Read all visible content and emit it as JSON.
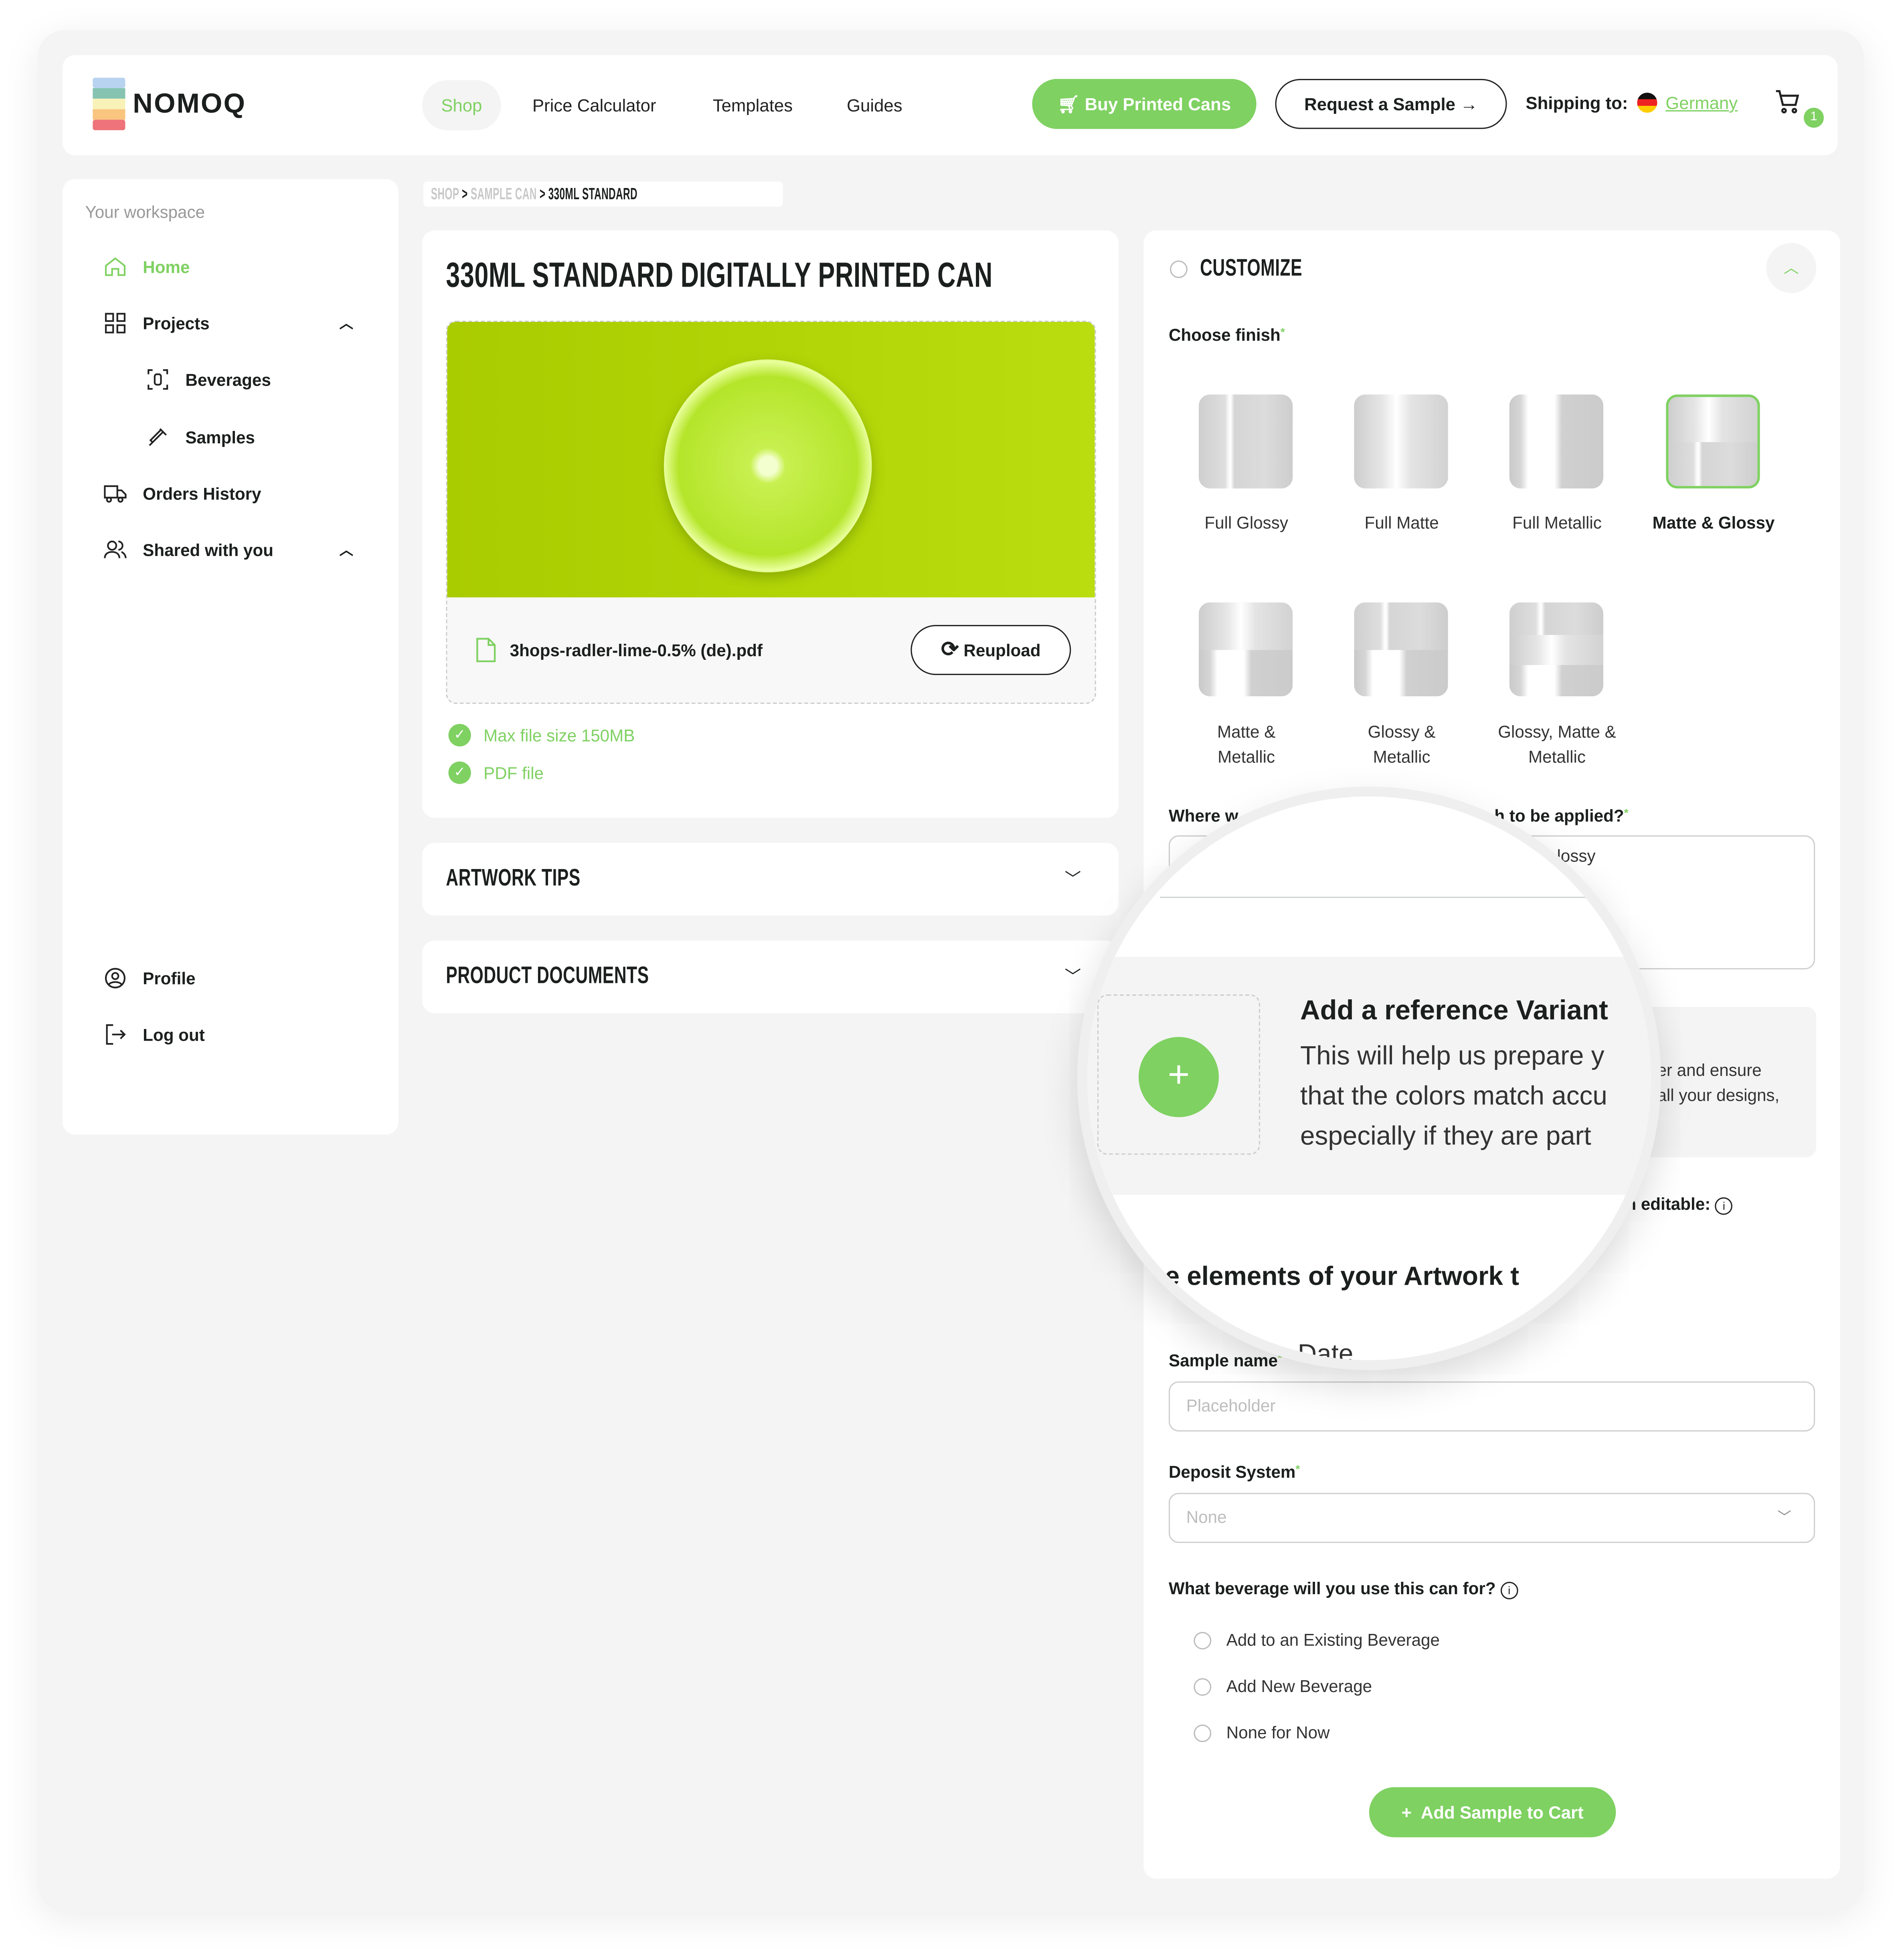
{
  "brand": {
    "name": "NOMOQ",
    "accent": "#7fd162"
  },
  "header": {
    "nav": [
      "Shop",
      "Price Calculator",
      "Templates",
      "Guides"
    ],
    "active_nav": "Shop",
    "buy_button": "Buy Printed Cans",
    "sample_button": "Request a Sample",
    "shipping_label": "Shipping to:",
    "shipping_country": "Germany",
    "cart_count": "1"
  },
  "sidebar": {
    "section": "Your workspace",
    "items": [
      {
        "label": "Home",
        "icon": "home-icon",
        "active": true
      },
      {
        "label": "Projects",
        "icon": "grid-icon",
        "expanded": true
      },
      {
        "label": "Beverages",
        "icon": "can-scan-icon",
        "sub": true
      },
      {
        "label": "Samples",
        "icon": "pipette-icon",
        "sub": true
      },
      {
        "label": "Orders History",
        "icon": "truck-icon"
      },
      {
        "label": "Shared with you",
        "icon": "users-icon",
        "expanded": true
      }
    ],
    "bottom": [
      {
        "label": "Profile",
        "icon": "user-circle-icon"
      },
      {
        "label": "Log out",
        "icon": "logout-icon"
      }
    ]
  },
  "breadcrumb": [
    "SHOP",
    "SAMPLE CAN",
    "330ML STANDARD"
  ],
  "product": {
    "title": "330ML STANDARD DIGITALLY PRINTED CAN",
    "file_name": "3hops-radler-lime-0.5% (de).pdf",
    "reupload": "Reupload",
    "checks": [
      "Max file size 150MB",
      "PDF file"
    ]
  },
  "accordions": [
    "ARTWORK TIPS",
    "PRODUCT DOCUMENTS"
  ],
  "customize": {
    "title": "CUSTOMIZE",
    "choose_finish": "Choose finish",
    "finishes": [
      {
        "label": "Full Glossy",
        "selected": false
      },
      {
        "label": "Full Matte",
        "selected": false
      },
      {
        "label": "Full Metallic",
        "selected": false
      },
      {
        "label": "Matte & Glossy",
        "selected": true
      },
      {
        "label": "Matte & Metallic",
        "selected": false
      },
      {
        "label": "Glossy & Metallic",
        "selected": false
      },
      {
        "label": "Glossy, Matte & Metallic",
        "selected": false
      }
    ],
    "where_label_start": "Where w",
    "where_label_end": "h to be applied?",
    "where_value_fragment": "lossy",
    "info_fragment_1": "er and ensure",
    "info_fragment_2": "all your designs,",
    "editable_fragment": "n editable:",
    "sample_name_label": "Sample name",
    "sample_name_placeholder": "Placeholder",
    "deposit_label": "Deposit System",
    "deposit_value": "None",
    "beverage_question": "What beverage will you use this can for?",
    "beverage_options": [
      "Add to an Existing Beverage",
      "Add New Beverage",
      "None for Now"
    ],
    "add_to_cart": "Add Sample to Cart"
  },
  "magnifier": {
    "heading": "Add a reference Variant",
    "lines": [
      "This will help us prepare y",
      "that the colors match accu",
      "especially if they are part"
    ],
    "value_fragment": "lossy",
    "elements_fragment": "e elements of your Artwork t",
    "date_fragment": "Date"
  }
}
